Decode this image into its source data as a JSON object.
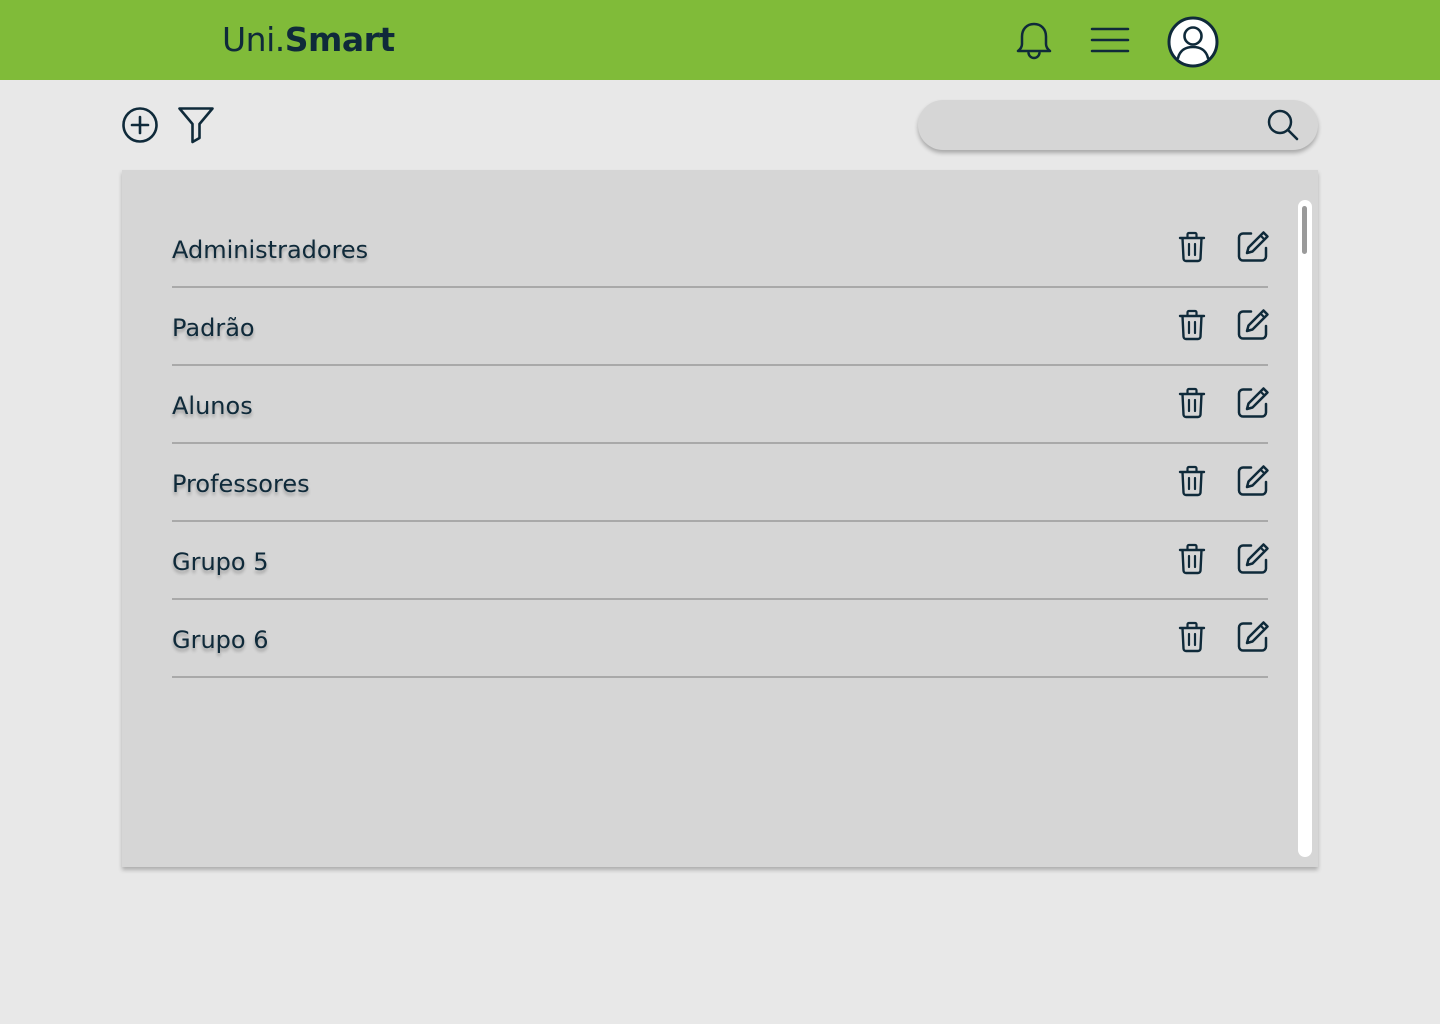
{
  "header": {
    "logo_part1": "Uni.",
    "logo_part2": "Smart",
    "bg_color": "#80bb39",
    "icons": [
      "bell-icon",
      "menu-icon",
      "user-avatar-icon"
    ]
  },
  "toolbar": {
    "icons": [
      "add-circle-icon",
      "filter-icon"
    ],
    "search": {
      "value": "",
      "placeholder": "",
      "icon": "search-icon"
    }
  },
  "groups": [
    {
      "label": "Administradores"
    },
    {
      "label": "Padrão"
    },
    {
      "label": "Alunos"
    },
    {
      "label": "Professores"
    },
    {
      "label": "Grupo 5"
    },
    {
      "label": "Grupo 6"
    }
  ],
  "row_actions": [
    "trash-icon",
    "edit-icon"
  ],
  "colors": {
    "text": "#0f2a3a",
    "panel": "#d6d6d6",
    "page": "#e8e8e8"
  }
}
